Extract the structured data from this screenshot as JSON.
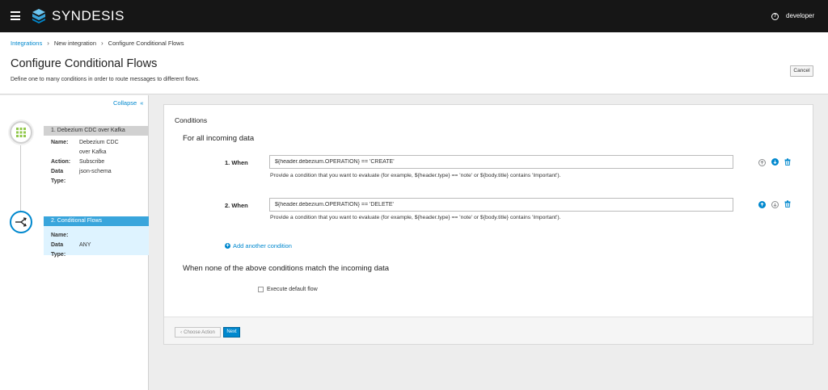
{
  "app": {
    "brand": "SYNDESIS",
    "user": "developer",
    "icons": {
      "menu": "hamburger-icon",
      "logo": "syndesis-logo",
      "help": "help-icon"
    }
  },
  "breadcrumb": {
    "items": [
      "Integrations",
      "New integration",
      "Configure Conditional Flows"
    ]
  },
  "header": {
    "title": "Configure Conditional Flows",
    "subtitle": "Define one to many conditions in order to route messages to different flows.",
    "cancel_label": "Cancel"
  },
  "sidebar": {
    "collapse_label": "Collapse",
    "steps": [
      {
        "title": "1. Debezium CDC over Kafka",
        "details": [
          {
            "key": "Name:",
            "value": "Debezium CDC over Kafka"
          },
          {
            "key": "Action:",
            "value": "Subscribe"
          },
          {
            "key": "Data Type:",
            "value": "json-schema"
          }
        ]
      },
      {
        "title": "2. Conditional Flows",
        "details": [
          {
            "key": "Name:",
            "value": ""
          },
          {
            "key": "Data Type:",
            "value": "ANY"
          }
        ]
      }
    ]
  },
  "main": {
    "conditions_title": "Conditions",
    "incoming_title": "For all incoming data",
    "conditions": [
      {
        "label": "1. When",
        "value": "${header.debezium.OPERATION} == 'CREATE'",
        "help": "Provide a condition that you want to evaluate (for example, ${header.type} == 'note' or ${body.title} contains 'Important')."
      },
      {
        "label": "2. When",
        "value": "${header.debezium.OPERATION} == 'DELETE'",
        "help": "Provide a condition that you want to evaluate (for example, ${header.type} == 'note' or ${body.title} contains 'Important')."
      }
    ],
    "add_condition_label": "Add another condition",
    "default_title": "When none of the above conditions match the incoming data",
    "default_flow_label": "Execute default flow",
    "back_label": "Choose Action",
    "next_label": "Next"
  },
  "colors": {
    "accent": "#0088ce",
    "topbar": "#161616",
    "active_step": "#39a5dc",
    "active_step_bg": "#def3ff"
  }
}
